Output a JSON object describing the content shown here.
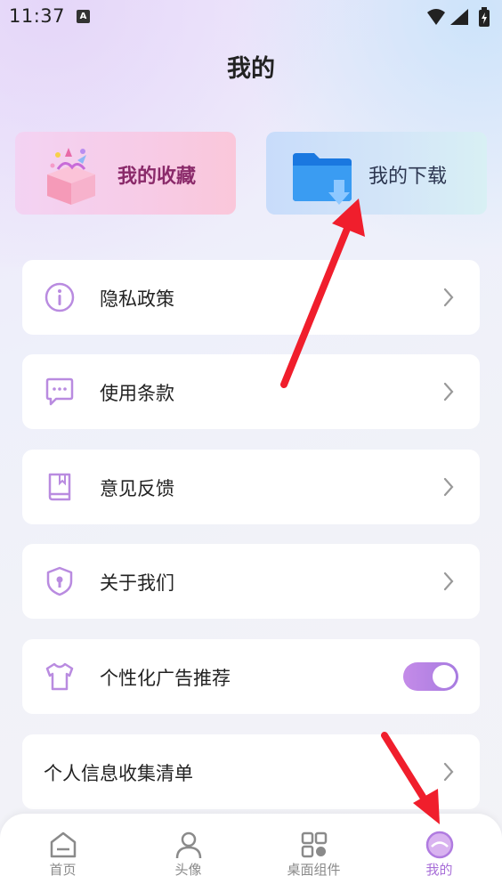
{
  "status_bar": {
    "time": "11:37",
    "notification_glyph": "A"
  },
  "header": {
    "title": "我的"
  },
  "cards": {
    "favorites_label": "我的收藏",
    "downloads_label": "我的下载"
  },
  "menu": {
    "items": [
      {
        "label": "隐私政策",
        "icon": "info-icon"
      },
      {
        "label": "使用条款",
        "icon": "chat-bubble-icon"
      },
      {
        "label": "意见反馈",
        "icon": "book-icon"
      },
      {
        "label": "关于我们",
        "icon": "shield-lock-icon"
      },
      {
        "label": "个性化广告推荐",
        "icon": "tshirt-icon",
        "toggle_on": true
      },
      {
        "label": "个人信息收集清单"
      }
    ]
  },
  "bottom_nav": {
    "items": [
      {
        "label": "首页",
        "icon": "home-icon"
      },
      {
        "label": "头像",
        "icon": "person-icon"
      },
      {
        "label": "桌面组件",
        "icon": "widgets-icon"
      },
      {
        "label": "我的",
        "icon": "profile-circle-icon",
        "active": true
      }
    ]
  },
  "colors": {
    "accent": "#a86fd8",
    "annotation_arrow": "#f01e2c"
  }
}
